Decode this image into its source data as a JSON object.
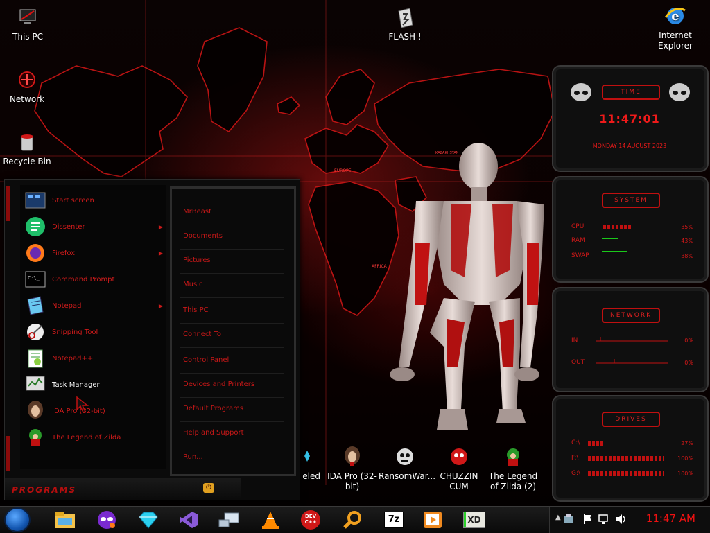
{
  "desktop_icons": [
    {
      "label": "This PC",
      "icon": "this-pc-icon"
    },
    {
      "label": "FLASH !",
      "icon": "flash-drive-icon"
    },
    {
      "label": "Internet Explorer",
      "icon": "internet-explorer-icon"
    },
    {
      "label": "Network",
      "icon": "network-icon"
    },
    {
      "label": "Recycle Bin",
      "icon": "recycle-bin-icon"
    },
    {
      "label": "eled",
      "icon": "app-icon"
    },
    {
      "label": "IDA Pro (32-bit)",
      "icon": "ida-pro-icon"
    },
    {
      "label": "RansomWar...",
      "icon": "ransomware-icon"
    },
    {
      "label": "CHUZZIN CUM",
      "icon": "chuzzin-icon"
    },
    {
      "label": "The Legend of Zilda (2)",
      "icon": "zilda-icon"
    }
  ],
  "map_labels": {
    "europe": "EUROPE",
    "africa": "AFRICA",
    "kazakhstan": "KAZAKHSTAN"
  },
  "start_menu": {
    "programs": [
      {
        "label": "Start screen",
        "icon": "start-screen-icon",
        "submenu": false
      },
      {
        "label": "Dissenter",
        "icon": "dissenter-icon",
        "submenu": true
      },
      {
        "label": "Firefox",
        "icon": "firefox-icon",
        "submenu": true
      },
      {
        "label": "Command Prompt",
        "icon": "command-prompt-icon",
        "submenu": false
      },
      {
        "label": "Notepad",
        "icon": "notepad-icon",
        "submenu": true
      },
      {
        "label": "Snipping Tool",
        "icon": "snipping-tool-icon",
        "submenu": false
      },
      {
        "label": "Notepad++",
        "icon": "notepad-plus-plus-icon",
        "submenu": false
      },
      {
        "label": "Task Manager",
        "icon": "task-manager-icon",
        "submenu": false
      },
      {
        "label": "IDA Pro (32-bit)",
        "icon": "ida-pro-icon",
        "submenu": false
      },
      {
        "label": "The Legend of Zilda",
        "icon": "zilda-icon",
        "submenu": false
      }
    ],
    "places": [
      "MrBeast",
      "Documents",
      "Pictures",
      "Music",
      "This PC",
      "Connect To",
      "Control Panel",
      "Devices and Printers",
      "Default Programs",
      "Help and Support",
      "Run..."
    ],
    "programs_label": "PROGRAMS"
  },
  "gadgets": {
    "time": {
      "title": "TIME",
      "clock": "11:47:01",
      "date": "MONDAY 14 AUGUST 2023"
    },
    "system": {
      "title": "SYSTEM",
      "rows": [
        {
          "label": "CPU",
          "value": "35%",
          "level": 0.35
        },
        {
          "label": "RAM",
          "value": "43%",
          "level": 0.43
        },
        {
          "label": "SWAP",
          "value": "38%",
          "level": 0.38
        }
      ]
    },
    "network": {
      "title": "NETWORK",
      "rows": [
        {
          "label": "IN",
          "value": "0%"
        },
        {
          "label": "OUT",
          "value": "0%"
        }
      ]
    },
    "drives": {
      "title": "DRIVES",
      "rows": [
        {
          "label": "C:\\",
          "value": "27%",
          "level": 0.27
        },
        {
          "label": "F:\\",
          "value": "100%",
          "level": 1.0
        },
        {
          "label": "G:\\",
          "value": "100%",
          "level": 1.0
        }
      ]
    }
  },
  "taskbar": {
    "pinned": [
      "file-explorer-icon",
      "tor-mask-icon",
      "gem-icon",
      "visual-studio-icon",
      "network-tool-icon",
      "vlc-icon",
      "devcpp-icon",
      "search-magnifier-icon",
      "seven-zip-icon",
      "media-player-icon",
      "xd-icon"
    ],
    "devcpp_label": "DEV C++",
    "seven_zip_label": "7z",
    "xd_label": "XD",
    "clock": "11:47 AM"
  },
  "colors": {
    "accent": "#d01818",
    "clock": "#ee1111",
    "gadget_border": "#3a3a3a"
  }
}
